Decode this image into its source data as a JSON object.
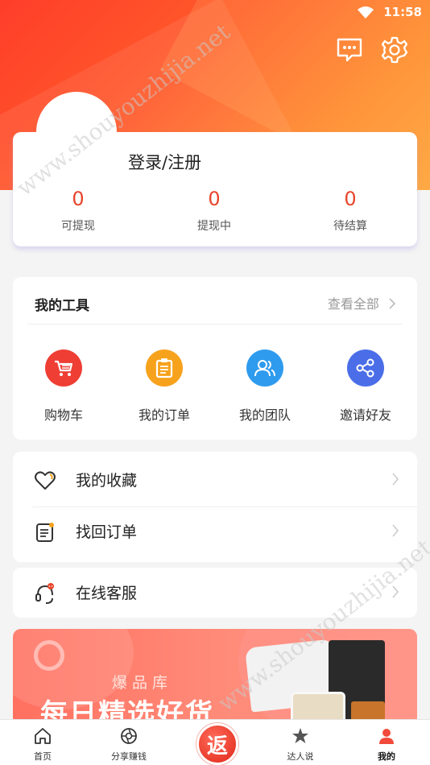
{
  "status_bar": {
    "time": "11:58"
  },
  "profile": {
    "login_label": "登录/注册",
    "stats": [
      {
        "value": "0",
        "label": "可提现"
      },
      {
        "value": "0",
        "label": "提现中"
      },
      {
        "value": "0",
        "label": "待结算"
      }
    ]
  },
  "tools": {
    "title": "我的工具",
    "view_all": "查看全部",
    "items": [
      {
        "label": "购物车",
        "icon": "cart-icon",
        "color": "#ef3e34"
      },
      {
        "label": "我的订单",
        "icon": "order-icon",
        "color": "#f7a21c"
      },
      {
        "label": "我的团队",
        "icon": "team-icon",
        "color": "#2f9bee"
      },
      {
        "label": "邀请好友",
        "icon": "share-icon",
        "color": "#4b6ee8"
      }
    ]
  },
  "menu": {
    "favorites": "我的收藏",
    "retrieve_order": "找回订单",
    "customer_service": "在线客服"
  },
  "banner": {
    "subtitle": "爆品库",
    "title": "每日精选好货"
  },
  "tabbar": {
    "items": [
      {
        "label": "首页"
      },
      {
        "label": "分享赚钱"
      },
      {
        "label": "返"
      },
      {
        "label": "达人说"
      },
      {
        "label": "我的"
      }
    ]
  },
  "watermark": "www.shouyouzhijia.net",
  "colors": {
    "accent": "#e8452c",
    "header_start": "#ff3d2a",
    "header_end": "#ffa33a"
  }
}
